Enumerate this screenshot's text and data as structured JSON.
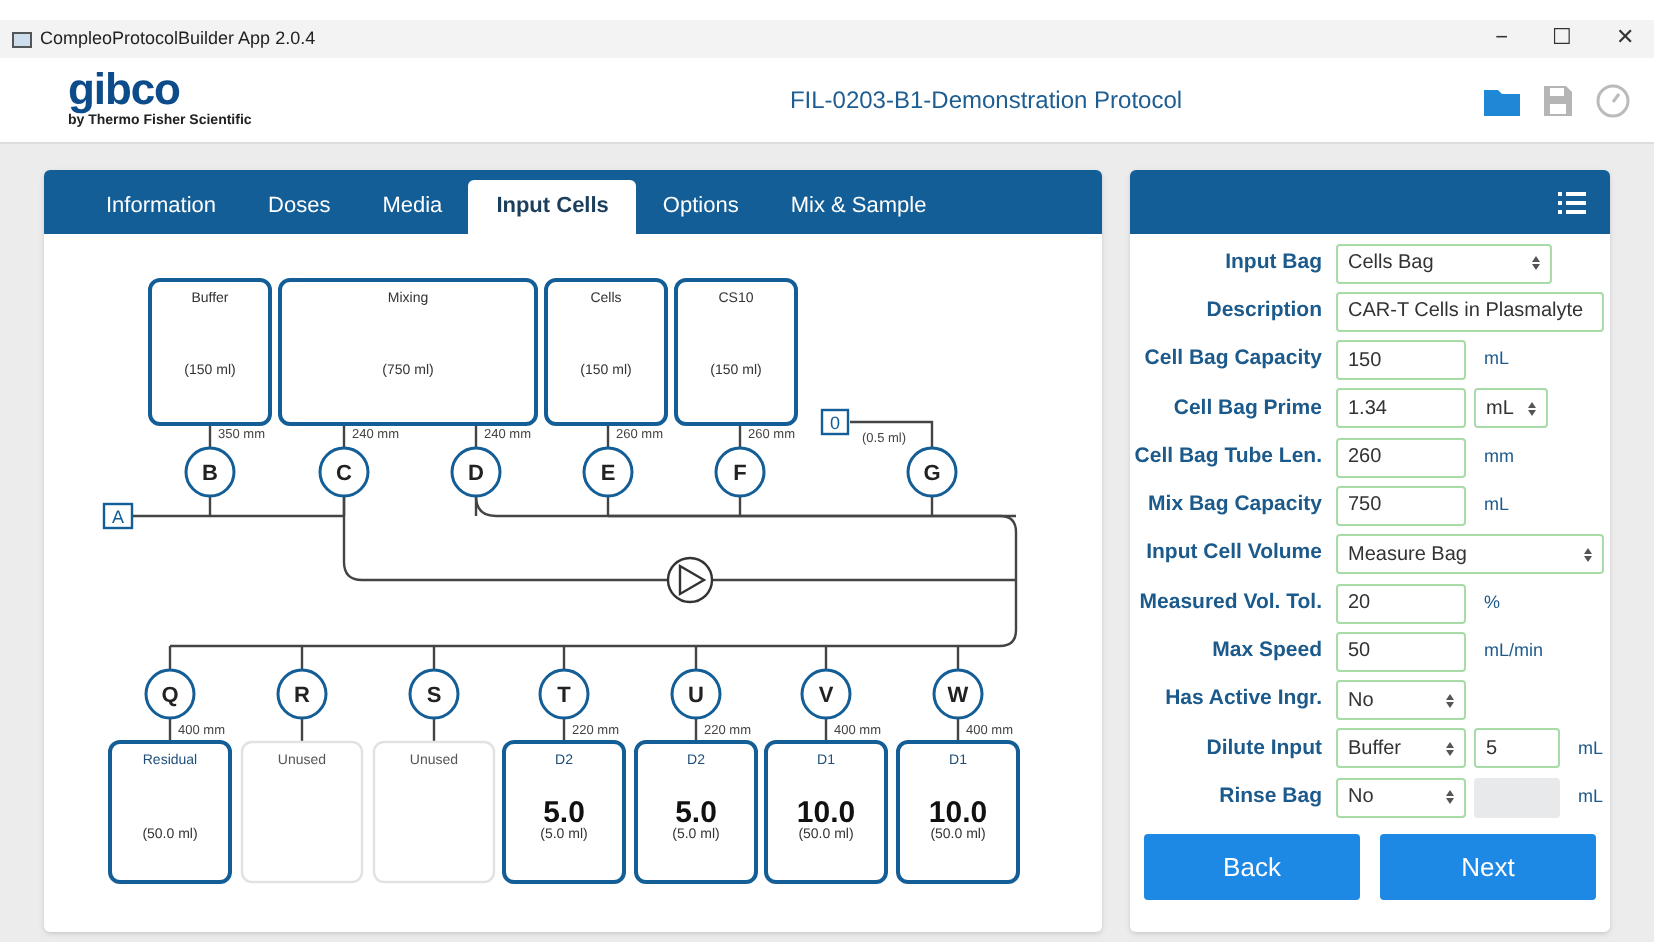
{
  "window": {
    "title": "CompleoProtocolBuilder App 2.0.4",
    "controls": [
      "−",
      "☐",
      "✕"
    ]
  },
  "header": {
    "brand": "gibco",
    "brand_sub": "by Thermo Fisher Scientific",
    "protocol": "FIL-0203-B1-Demonstration Protocol"
  },
  "tabs": [
    {
      "label": "Information",
      "selected": false
    },
    {
      "label": "Doses",
      "selected": false
    },
    {
      "label": "Media",
      "selected": false
    },
    {
      "label": "Input Cells",
      "selected": true
    },
    {
      "label": "Options",
      "selected": false
    },
    {
      "label": "Mix & Sample",
      "selected": false
    }
  ],
  "diagram": {
    "inlet": "A",
    "outlet": "0",
    "outlet_volume": "(0.5 ml)",
    "top_bags": [
      {
        "name": "Buffer",
        "volume": "(150 ml)"
      },
      {
        "name": "Mixing",
        "volume": "(750 ml)"
      },
      {
        "name": "Cells",
        "volume": "(150 ml)"
      },
      {
        "name": "CS10",
        "volume": "(150 ml)"
      }
    ],
    "top_ports": [
      {
        "letter": "B",
        "tube": "350 mm"
      },
      {
        "letter": "C",
        "tube": "240 mm"
      },
      {
        "letter": "D",
        "tube": "240 mm"
      },
      {
        "letter": "E",
        "tube": "260 mm"
      },
      {
        "letter": "F",
        "tube": "260 mm"
      },
      {
        "letter": "G"
      }
    ],
    "bottom_ports": [
      {
        "letter": "Q",
        "tube": "400 mm",
        "kind": "bag",
        "name": "Residual",
        "volume": "(50.0 ml)"
      },
      {
        "letter": "R",
        "kind": "unused",
        "name": "Unused"
      },
      {
        "letter": "S",
        "kind": "unused",
        "name": "Unused"
      },
      {
        "letter": "T",
        "tube": "220 mm",
        "kind": "bag",
        "name": "D2",
        "dose": "5.0",
        "volume": "(5.0 ml)"
      },
      {
        "letter": "U",
        "tube": "220 mm",
        "kind": "bag",
        "name": "D2",
        "dose": "5.0",
        "volume": "(5.0 ml)"
      },
      {
        "letter": "V",
        "tube": "400 mm",
        "kind": "bag",
        "name": "D1",
        "dose": "10.0",
        "volume": "(50.0 ml)"
      },
      {
        "letter": "W",
        "tube": "400 mm",
        "kind": "bag",
        "name": "D1",
        "dose": "10.0",
        "volume": "(50.0 ml)"
      }
    ]
  },
  "form": {
    "rows": [
      {
        "label": "Input Bag",
        "controls": [
          {
            "kind": "select",
            "value": "Cells Bag"
          }
        ]
      },
      {
        "label": "Description",
        "controls": [
          {
            "kind": "input_wide",
            "value": "CAR-T Cells in Plasmalyte"
          }
        ]
      },
      {
        "label": "Cell Bag Capacity",
        "controls": [
          {
            "kind": "input",
            "value": "150"
          },
          {
            "kind": "unit",
            "value": "mL"
          }
        ]
      },
      {
        "label": "Cell Bag Prime",
        "controls": [
          {
            "kind": "input",
            "value": "1.34"
          },
          {
            "kind": "unit_select",
            "value": "mL"
          }
        ]
      },
      {
        "label": "Cell Bag Tube Len.",
        "controls": [
          {
            "kind": "input",
            "value": "260"
          },
          {
            "kind": "unit",
            "value": "mm"
          }
        ]
      },
      {
        "label": "Mix Bag Capacity",
        "controls": [
          {
            "kind": "input",
            "value": "750"
          },
          {
            "kind": "unit",
            "value": "mL"
          }
        ]
      },
      {
        "label": "Input Cell Volume",
        "controls": [
          {
            "kind": "select_wide",
            "value": "Measure Bag"
          }
        ]
      },
      {
        "label": "Measured Vol. Tol.",
        "controls": [
          {
            "kind": "input",
            "value": "20"
          },
          {
            "kind": "unit",
            "value": "%"
          }
        ]
      },
      {
        "label": "Max Speed",
        "controls": [
          {
            "kind": "input",
            "value": "50"
          },
          {
            "kind": "unit",
            "value": "mL/min"
          }
        ]
      },
      {
        "label": "Has Active Ingr.",
        "controls": [
          {
            "kind": "select_short",
            "value": "No"
          }
        ]
      },
      {
        "label": "Dilute Input",
        "controls": [
          {
            "kind": "select_short",
            "value": "Buffer"
          },
          {
            "kind": "input_small",
            "value": "5"
          },
          {
            "kind": "unit",
            "value": "mL"
          }
        ]
      },
      {
        "label": "Rinse Bag",
        "controls": [
          {
            "kind": "select_short",
            "value": "No"
          },
          {
            "kind": "input_disabled"
          },
          {
            "kind": "unit",
            "value": "mL"
          }
        ]
      }
    ],
    "buttons": [
      "Back",
      "Next"
    ]
  }
}
